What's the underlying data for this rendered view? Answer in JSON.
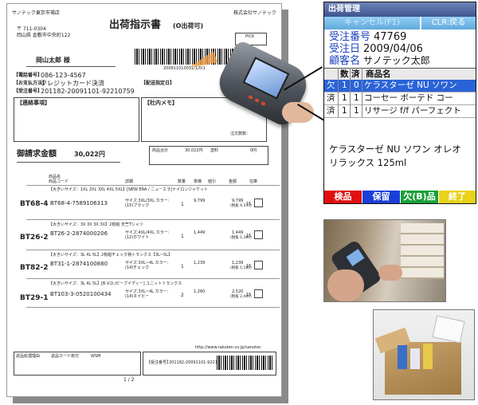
{
  "document": {
    "company_top": "サノテック東京市場店",
    "postal": "〒 711-0304",
    "address": "岡山県 倉敷市中央町122",
    "title": "出荷指示書",
    "title_sub": "(O出荷可)",
    "company_right": "株式会社サノテック",
    "pick_label": "PICK",
    "barcode_number": "200911010031/1/0/1",
    "recipient": "岡山太郎 様",
    "tel_label": "【電話番号】",
    "tel": "086-123-4567",
    "payment_label": "【お支払方法】",
    "payment": "クレジットカード決済",
    "order_label": "【受注番号】",
    "order": "201182-20091101-92210759",
    "ship_label": "【配送指定日】",
    "contact_label": "【連絡事項】",
    "memo_label": "【社内メモ】",
    "note_count": "注文数数：",
    "invoice_label": "御請求金額",
    "invoice_amount": "30,022円",
    "subtotal_label": "商品合計",
    "subtotal": "30,022円",
    "shipping_label": "送料",
    "shipping": "0円",
    "col_headers": [
      "商品名",
      "商品コード",
      "詳細",
      "数量",
      "単価",
      "値引",
      "金額",
      "在庫"
    ],
    "items": [
      {
        "id": "BT68-4",
        "name": "【大きいサイズ：1XL 2XL 3XL 4XL 5XL】[NEW ERA / ニューエラ]ナイロンジャケット",
        "code": "BT68-4-7589106313",
        "detail": "サイズ:3XL/3XL カラー:(15)ブラック",
        "qty": "1",
        "price": "9,799",
        "amount": "9,799",
        "tax": "(税抜 9,333)",
        "stock": "15"
      },
      {
        "id": "BT26-2",
        "name": "【大きいサイズ：3X 3X 3X 3X】2枚組 天竺Tシャツ",
        "code": "BT26-2-2874000206",
        "detail": "サイズ:4XL/4XL カラー:(12)ホワイト",
        "qty": "1",
        "price": "1,449",
        "amount": "1,449",
        "tax": "(税抜 1,380)",
        "stock": "15"
      },
      {
        "id": "BT82-2",
        "name": "【大きいサイズ：3L 4L 5L】2枚組チェック柄トランクス【3L~5L】",
        "code": "BT31-1-2874100880",
        "detail": "サイズ:3XL~4L カラー:(14)チェック",
        "qty": "1",
        "price": "1,239",
        "amount": "1,239",
        "tax": "(税抜 1,180)",
        "stock": "15"
      },
      {
        "id": "BT29-1",
        "name": "【大きいサイズ：3L 4L 5L】[B.V.D./ビーブイディー] ユニットトランクス",
        "code": "BT103-3-0520100434",
        "detail": "サイズ:3XL~4L カラー:(14)ネイビー",
        "qty": "2",
        "price": "1,260",
        "amount": "2,520",
        "tax": "(税抜 2,400)",
        "stock": "15"
      }
    ],
    "footer_url": "http://www.rakuten.co.jp/sanotec",
    "footer_label1": "返品処理理由",
    "footer_label2": "返品カード枚付",
    "footer_label3": "WSM",
    "footer_order_label": "【受注番号】",
    "footer_order": "201182-20091101-92210759",
    "page": "1 / 2"
  },
  "phone": {
    "title": "出荷管理",
    "btn_left": "キャンセル(F1)",
    "btn_right": "CLR:戻る",
    "order_label": "受注番号",
    "order_value": "47769",
    "date_label": "受注日",
    "date_value": "2009/04/06",
    "customer_label": "顧客名",
    "customer_value": "サノテック太郎",
    "headers": [
      "",
      "数",
      "済",
      "商品名"
    ],
    "rows": [
      {
        "status": "欠",
        "num": "1",
        "done": "0",
        "name": "ケラスターゼ NU ソワン"
      },
      {
        "status": "済",
        "num": "1",
        "done": "1",
        "name": "コーセー ボーテド コー"
      },
      {
        "status": "済",
        "num": "1",
        "done": "1",
        "name": "リサージ f/f パーフェクト"
      }
    ],
    "detail_text": "ケラスターゼ NU ソワン オレオ リラックス 125ml",
    "fkeys": [
      {
        "label": "検品",
        "color": "#e01010"
      },
      {
        "label": "保留",
        "color": "#1a3fd8"
      },
      {
        "label": "欠(B)品",
        "color": "#18a038"
      },
      {
        "label": "終了",
        "color": "#e8d21a"
      }
    ]
  }
}
